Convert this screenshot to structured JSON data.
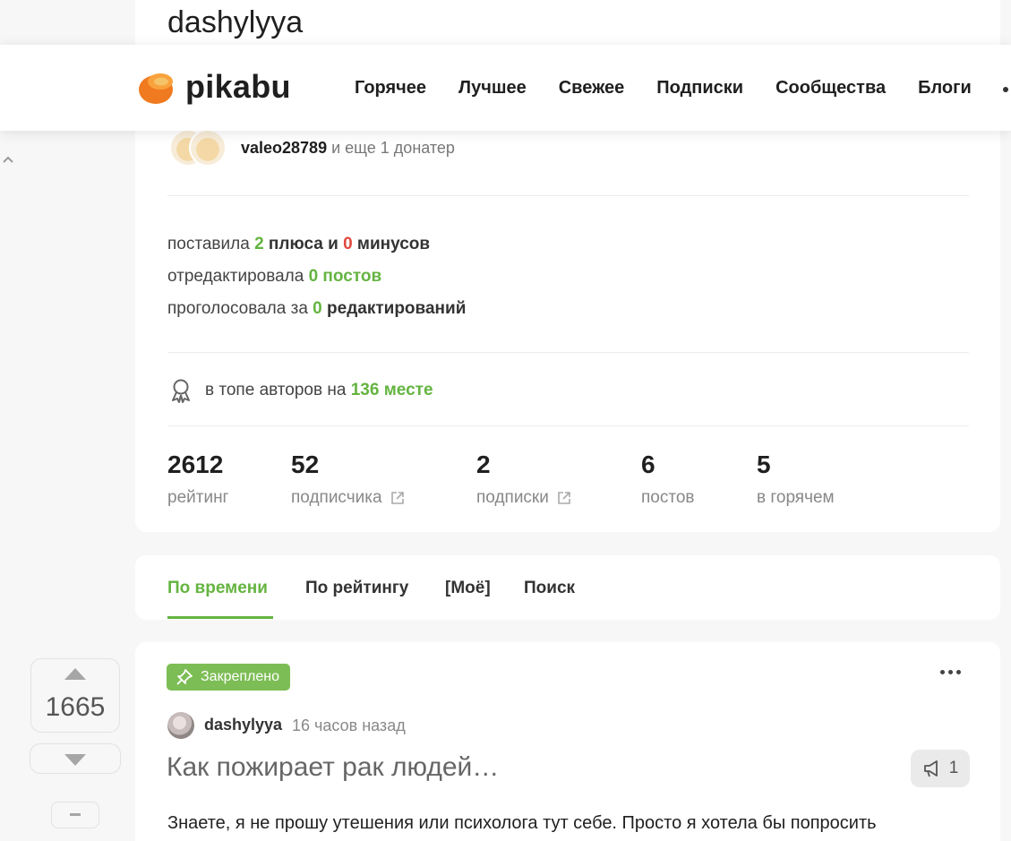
{
  "page": {
    "username": "dashylyya"
  },
  "header": {
    "brand": "pikabu",
    "nav": [
      "Горячее",
      "Лучшее",
      "Свежее",
      "Подписки",
      "Сообщества",
      "Блоги"
    ]
  },
  "profile": {
    "donators": {
      "name": "valeo28789",
      "rest": "и еще 1 донатер"
    },
    "activity": {
      "line1": {
        "prefix": "поставила",
        "plus_count": "2",
        "plus_label": "плюса и",
        "minus_count": "0",
        "minus_label": "минусов"
      },
      "line2": {
        "prefix": "отредактировала",
        "value": "0 постов"
      },
      "line3": {
        "prefix": "проголосовала за",
        "count": "0",
        "label": "редактирований"
      }
    },
    "rank": {
      "prefix": "в топе авторов на",
      "value": "136 месте"
    },
    "metrics": [
      {
        "value": "2612",
        "label": "рейтинг"
      },
      {
        "value": "52",
        "label": "подписчика"
      },
      {
        "value": "2",
        "label": "подписки"
      },
      {
        "value": "6",
        "label": "постов"
      },
      {
        "value": "5",
        "label": "в горячем"
      }
    ]
  },
  "tabs": [
    "По времени",
    "По рейтингу",
    "[Моё]",
    "Поиск"
  ],
  "post": {
    "rating": "1665",
    "pinned_label": "Закреплено",
    "author": "dashylyya",
    "time": "16 часов назад",
    "title": "Как пожирает рак людей…",
    "comments": "1",
    "text": "Знаете, я не прошу утешения или психолога тут себе. Просто я хотела бы попросить"
  },
  "colors": {
    "accent_green": "#64b440",
    "minus_red": "#e0483e",
    "pinned_badge": "#7dbd55",
    "logo_orange": "#f07a1f"
  }
}
